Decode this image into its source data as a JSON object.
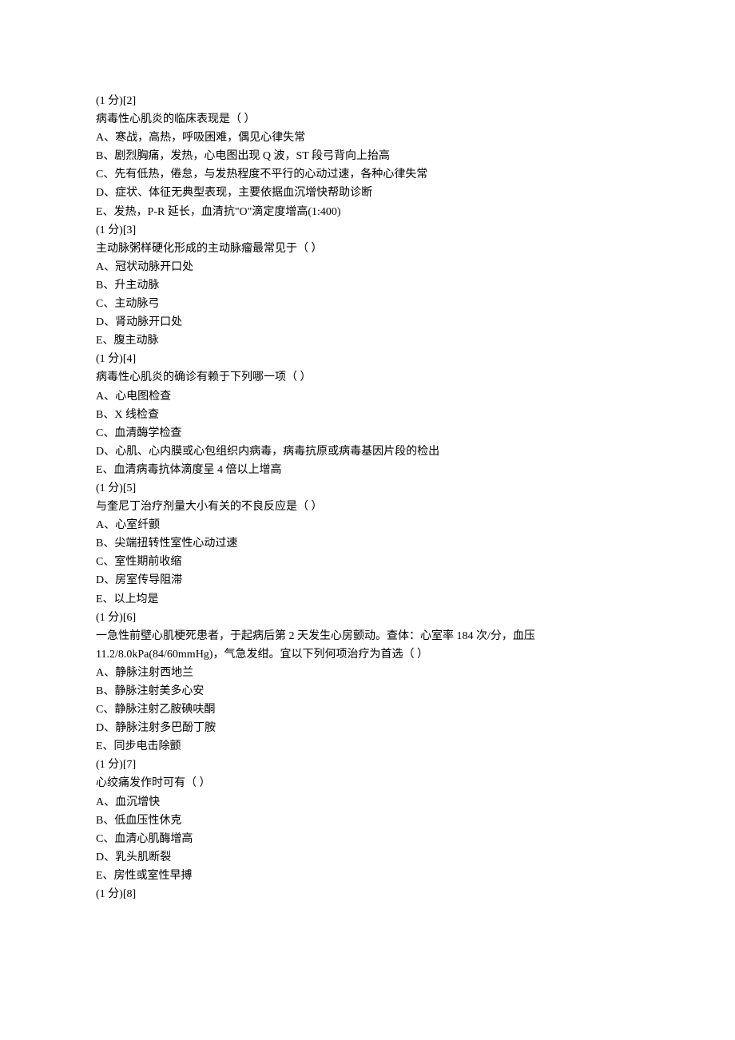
{
  "questions": [
    {
      "header": "(1 分)[2]",
      "stem": "病毒性心肌炎的临床表现是（  ）",
      "options": [
        "A、寒战，高热，呼吸困难，偶见心律失常",
        "B、剧烈胸痛，发热，心电图出现 Q 波，ST 段弓背向上抬高",
        "C、先有低热，倦怠，与发热程度不平行的心动过速，各种心律失常",
        "D、症状、体征无典型表现，主要依据血沉增快帮助诊断",
        "E、发热，P-R 延长，血清抗\"O\"滴定度增高(1:400)"
      ]
    },
    {
      "header": "(1 分)[3]",
      "stem": "主动脉粥样硬化形成的主动脉瘤最常见于（  ）",
      "options": [
        "A、冠状动脉开口处",
        "B、升主动脉",
        "C、主动脉弓",
        "D、肾动脉开口处",
        "E、腹主动脉"
      ]
    },
    {
      "header": "(1 分)[4]",
      "stem": "病毒性心肌炎的确诊有赖于下列哪一项（  ）",
      "options": [
        "A、心电图检查",
        "B、X 线检查",
        "C、血清酶学检查",
        "D、心肌、心内膜或心包组织内病毒，病毒抗原或病毒基因片段的检出",
        "E、血清病毒抗体滴度呈 4 倍以上增高"
      ]
    },
    {
      "header": "(1 分)[5]",
      "stem": "与奎尼丁治疗剂量大小有关的不良反应是（  ）",
      "options": [
        "A、心室纤颤",
        "B、尖端扭转性室性心动过速",
        "C、室性期前收缩",
        "D、房室传导阻滞",
        "E、以上均是"
      ]
    },
    {
      "header": "(1 分)[6]",
      "stem": "一急性前壁心肌梗死患者，于起病后第 2 天发生心房颤动。查体：心室率 184 次/分，血压 11.2/8.0kPa(84/60mmHg)，气急发绀。宜以下列何项治疗为首选（  ）",
      "options": [
        "A、静脉注射西地兰",
        "B、静脉注射美多心安",
        "C、静脉注射乙胺碘呋酮",
        "D、静脉注射多巴酚丁胺",
        "E、同步电击除颤"
      ]
    },
    {
      "header": "(1 分)[7]",
      "stem": "心绞痛发作时可有（  ）",
      "options": [
        "A、血沉增快",
        "B、低血压性休克",
        "C、血清心肌酶增高",
        "D、乳头肌断裂",
        "E、房性或室性早搏"
      ]
    },
    {
      "header": "(1 分)[8]",
      "stem": "",
      "options": []
    }
  ]
}
